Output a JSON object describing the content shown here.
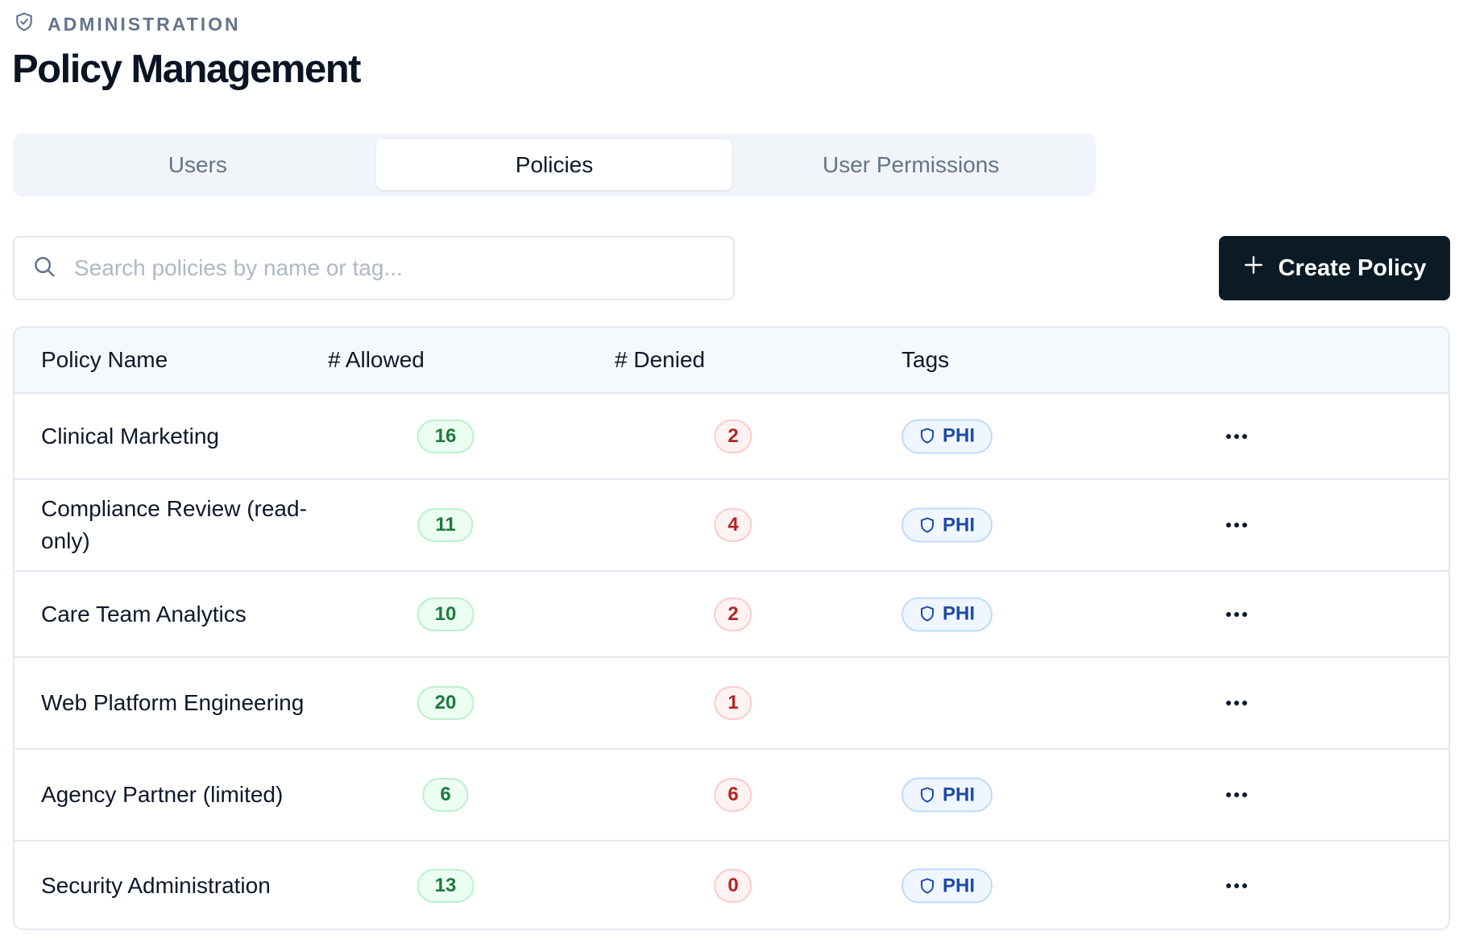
{
  "header": {
    "eyebrow": "ADMINISTRATION",
    "eyebrow_icon": "shield-check-icon",
    "title": "Policy Management"
  },
  "tabs": [
    {
      "label": "Users",
      "active": false
    },
    {
      "label": "Policies",
      "active": true
    },
    {
      "label": "User Permissions",
      "active": false
    }
  ],
  "search": {
    "placeholder": "Search policies by name or tag...",
    "value": "",
    "icon": "search-icon"
  },
  "create_button": {
    "label": "Create Policy",
    "icon": "plus-icon"
  },
  "table": {
    "columns": {
      "name": "Policy Name",
      "allowed": "# Allowed",
      "denied": "# Denied",
      "tags": "Tags"
    },
    "rows": [
      {
        "name": "Clinical Marketing",
        "allowed": "16",
        "denied": "2",
        "tag": "PHI"
      },
      {
        "name": "Compliance Review (read-only)",
        "allowed": "11",
        "denied": "4",
        "tag": "PHI"
      },
      {
        "name": "Care Team Analytics",
        "allowed": "10",
        "denied": "2",
        "tag": "PHI"
      },
      {
        "name": "Web Platform Engineering",
        "allowed": "20",
        "denied": "1",
        "tag": null
      },
      {
        "name": "Agency Partner (limited)",
        "allowed": "6",
        "denied": "6",
        "tag": "PHI"
      },
      {
        "name": "Security Administration",
        "allowed": "13",
        "denied": "0",
        "tag": "PHI"
      }
    ],
    "row_action_icon": "more-horizontal-icon"
  },
  "colors": {
    "primary_button": "#0b1b26",
    "allowed_text": "#1e7a3d",
    "allowed_bg": "#ecfdf2",
    "denied_text": "#b42323",
    "denied_bg": "#fef2f2",
    "tag_text": "#1e4ba8",
    "tag_bg": "#eff6ff"
  }
}
